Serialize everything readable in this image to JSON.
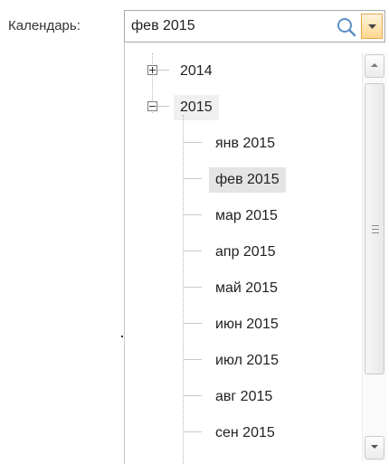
{
  "field": {
    "label": "Календарь:",
    "value": "фев 2015"
  },
  "icons": {
    "search": "search-icon",
    "dropdown": "chevron-down-icon"
  },
  "tree": {
    "years": [
      {
        "label": "2014",
        "expanded": false
      },
      {
        "label": "2015",
        "expanded": true
      }
    ],
    "months": [
      "янв 2015",
      "фев 2015",
      "мар 2015",
      "апр 2015",
      "май 2015",
      "июн 2015",
      "июл 2015",
      "авг 2015",
      "сен 2015"
    ],
    "selected": "фев 2015"
  },
  "colors": {
    "accent_border": "#e8a64d",
    "selection": "#e4e4e4"
  }
}
